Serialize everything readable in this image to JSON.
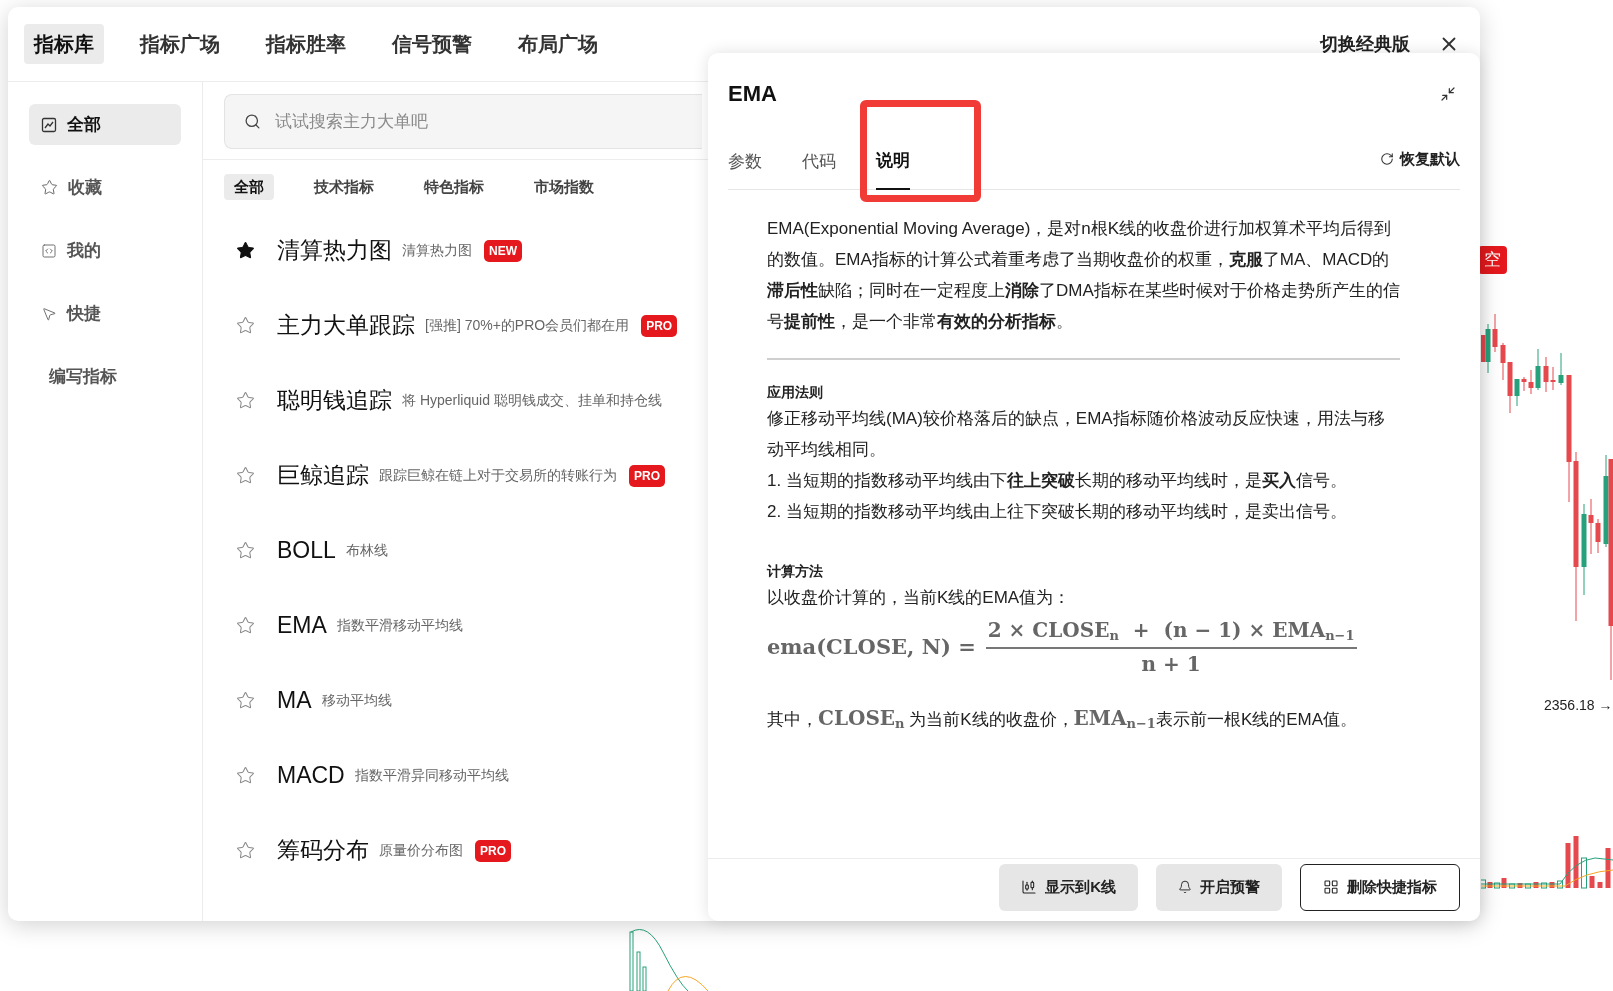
{
  "background_chart": {
    "badge": "空",
    "price_label": "2356.18 →"
  },
  "nav_tabs": [
    {
      "label": "指标库",
      "selected": true
    },
    {
      "label": "指标广场",
      "selected": false
    },
    {
      "label": "指标胜率",
      "selected": false
    },
    {
      "label": "信号预警",
      "selected": false
    },
    {
      "label": "布局广场",
      "selected": false
    }
  ],
  "switch_link": "切换经典版",
  "sidebar": {
    "items": [
      {
        "label": "全部",
        "kind": "chart",
        "selected": true
      },
      {
        "label": "收藏",
        "kind": "star",
        "selected": false
      },
      {
        "label": "我的",
        "kind": "code",
        "selected": false
      },
      {
        "label": "快捷",
        "kind": "pointer",
        "selected": false
      },
      {
        "label": "编写指标",
        "kind": "plain",
        "selected": false
      }
    ]
  },
  "search": {
    "placeholder": "试试搜索主力大单吧"
  },
  "filters": [
    {
      "label": "全部",
      "selected": true
    },
    {
      "label": "技术指标",
      "selected": false
    },
    {
      "label": "特色指标",
      "selected": false
    },
    {
      "label": "市场指数",
      "selected": false
    }
  ],
  "indicators": [
    {
      "name": "清算热力图",
      "description": "清算热力图",
      "badge": "NEW",
      "favorite": true
    },
    {
      "name": "主力大单跟踪",
      "description": "[强推] 70%+的PRO会员们都在用",
      "badge": "PRO",
      "favorite": false
    },
    {
      "name": "聪明钱追踪",
      "description": "将 Hyperliquid 聪明钱成交、挂单和持仓线",
      "favorite": false
    },
    {
      "name": "巨鲸追踪",
      "description": "跟踪巨鲸在链上对于交易所的转账行为",
      "badge": "PRO",
      "favorite": false
    },
    {
      "name": "BOLL",
      "description": "布林线",
      "favorite": false
    },
    {
      "name": "EMA",
      "description": "指数平滑移动平均线",
      "favorite": false
    },
    {
      "name": "MA",
      "description": "移动平均线",
      "favorite": false
    },
    {
      "name": "MACD",
      "description": "指数平滑异同移动平均线",
      "favorite": false
    },
    {
      "name": "筹码分布",
      "description": "原量价分布图",
      "badge": "PRO",
      "favorite": false
    }
  ],
  "panel": {
    "title": "EMA",
    "tabs": [
      {
        "label": "参数",
        "selected": false,
        "highlighted": false
      },
      {
        "label": "代码",
        "selected": false,
        "highlighted": false
      },
      {
        "label": "说明",
        "selected": true,
        "highlighted": true
      }
    ],
    "reset": "恢复默认",
    "intro": "EMA(Exponential Moving Average)，是对n根K线的收盘价进行加权算术平均后得到的数值。EMA指标的计算公式着重考虑了当期收盘价的权重，**克服**了MA、MACD的**滞后性**缺陷；同时在一定程度上**消除**了DMA指标在某些时候对于价格走势所产生的信号**提前性**，是一个非常**有效的分析指标**。",
    "rules": {
      "heading": "应用法则",
      "text": "修正移动平均线(MA)较价格落后的缺点，EMA指标随价格波动反应快速，用法与移动平均线相同。",
      "items": [
        "1. 当短期的指数移动平均线由下**往上突破**长期的移动平均线时，是**买入**信号。",
        "2. 当短期的指数移动平均线由上往下突破长期的移动平均线时，是卖出信号。"
      ]
    },
    "method": {
      "heading": "计算方法",
      "text": "以收盘价计算的，当前K线的EMA值为：",
      "formula": {
        "lhs": "ema(CLOSE, N) =",
        "numerator": "2 × CLOSE$_{n}$  +  (n − 1) × EMA$_{n−1}$",
        "denominator": "n + 1"
      },
      "note": [
        {
          "kind": "text",
          "text": "其中，"
        },
        {
          "kind": "math",
          "text": "CLOSE$_{n}$"
        },
        {
          "kind": "text",
          "text": " 为当前K线的收盘价，"
        },
        {
          "kind": "math",
          "text": "EMA$_{n−1}$"
        },
        {
          "kind": "text",
          "text": "表示前一根K线的EMA值。"
        }
      ]
    },
    "buttons": [
      {
        "label": "显示到K线",
        "kind": "candles",
        "outlined": false
      },
      {
        "label": "开启预警",
        "kind": "bell",
        "outlined": false
      },
      {
        "label": "删除快捷指标",
        "kind": "grid",
        "outlined": true
      }
    ]
  }
}
